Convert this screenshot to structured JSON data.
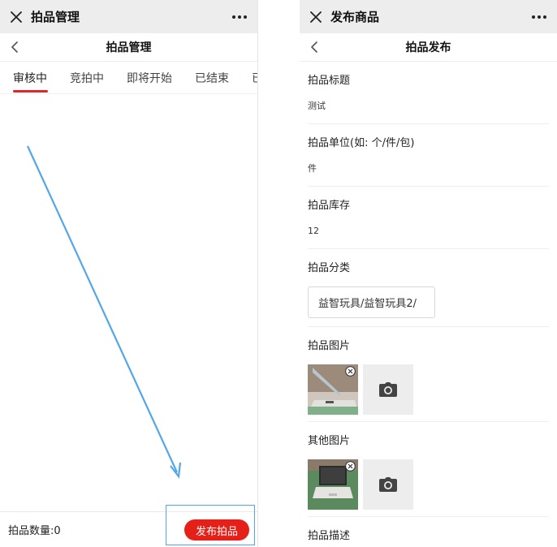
{
  "left": {
    "titlebar": {
      "title": "拍品管理"
    },
    "navbar": {
      "title": "拍品管理"
    },
    "tabs": [
      {
        "label": "审核中",
        "active": true
      },
      {
        "label": "竞拍中",
        "active": false
      },
      {
        "label": "即将开始",
        "active": false
      },
      {
        "label": "已结束",
        "active": false
      },
      {
        "label": "已流",
        "active": false
      }
    ],
    "footer": {
      "count_label": "拍品数量:0",
      "publish_label": "发布拍品"
    }
  },
  "right": {
    "titlebar": {
      "title": "发布商品"
    },
    "navbar": {
      "title": "拍品发布"
    },
    "fields": {
      "title": {
        "label": "拍品标题",
        "value": "测试"
      },
      "unit": {
        "label": "拍品单位(如: 个/件/包)",
        "value": "件"
      },
      "stock": {
        "label": "拍品库存",
        "value": "12"
      },
      "category": {
        "label": "拍品分类",
        "value": "益智玩具/益智玩具2/"
      },
      "images": {
        "label": "拍品图片"
      },
      "other_images": {
        "label": "其他图片"
      },
      "description": {
        "label": "拍品描述"
      }
    }
  },
  "colors": {
    "accent_red": "#e42019",
    "tab_indicator": "#e0262b",
    "annotation_blue": "#53a7e8",
    "titlebar_bg": "#ededed"
  },
  "icons": {
    "close": "close-icon",
    "more": "more-icon",
    "back": "chevron-left-icon",
    "camera": "camera-icon",
    "delete": "delete-icon"
  }
}
